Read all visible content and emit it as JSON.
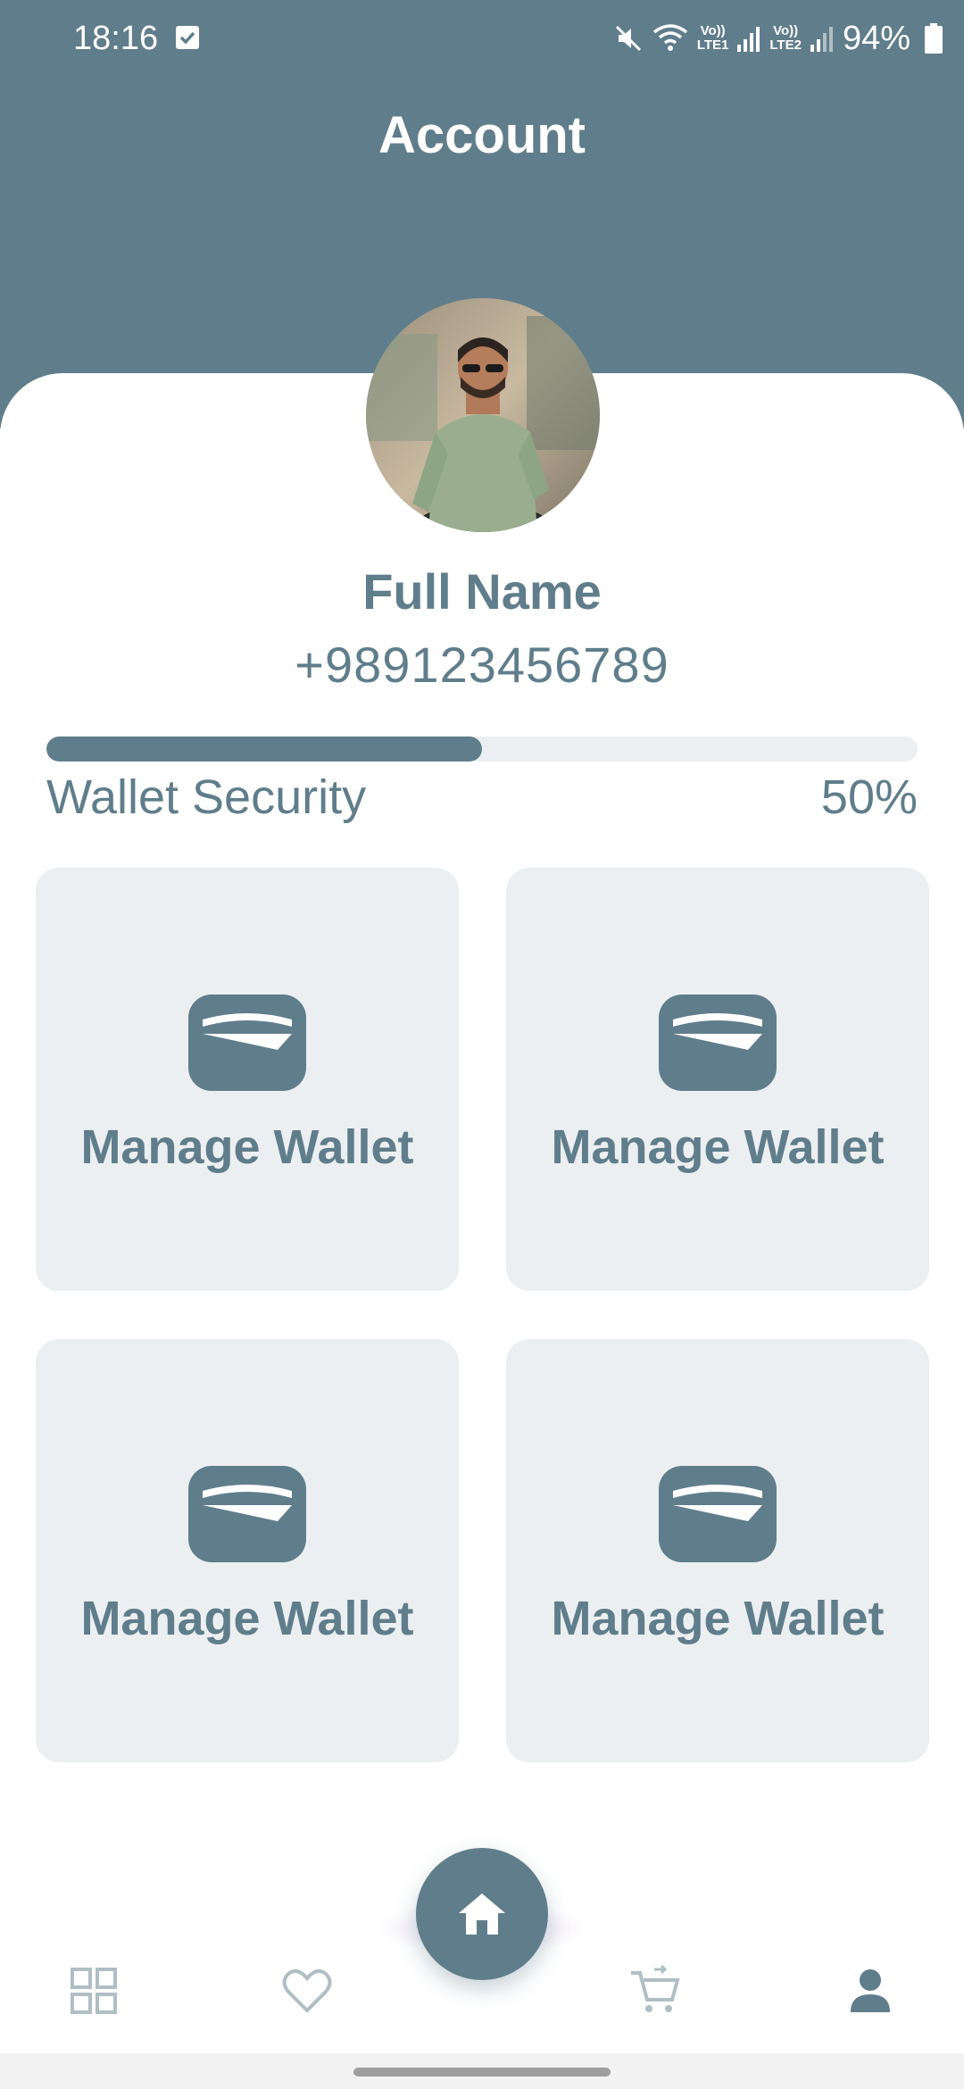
{
  "status_bar": {
    "time": "18:16",
    "battery_percent": "94%",
    "sim1_label_top": "Vo))",
    "sim1_label_bottom": "LTE1",
    "sim2_label_top": "Vo))",
    "sim2_label_bottom": "LTE2",
    "icons": [
      "checkbox-notification-icon",
      "mute-icon",
      "wifi-icon",
      "signal-icon",
      "battery-icon"
    ]
  },
  "header": {
    "title": "Account"
  },
  "profile": {
    "name": "Full Name",
    "phone": "+989123456789",
    "avatar": "profile-photo"
  },
  "wallet_security": {
    "label": "Wallet Security",
    "value_text": "50%",
    "progress": 0.5
  },
  "tiles": [
    {
      "label": "Manage Wallet",
      "icon": "wallet-icon"
    },
    {
      "label": "Manage Wallet",
      "icon": "wallet-icon"
    },
    {
      "label": "Manage Wallet",
      "icon": "wallet-icon"
    },
    {
      "label": "Manage Wallet",
      "icon": "wallet-icon"
    }
  ],
  "bottom_nav": {
    "items": [
      "grid-icon",
      "heart-icon",
      "home-icon",
      "cart-icon",
      "person-icon"
    ],
    "active": "person-icon"
  },
  "colors": {
    "primary": "#607d8b",
    "tile_bg": "#eceff1",
    "inactive_icon": "#b0bec5"
  }
}
